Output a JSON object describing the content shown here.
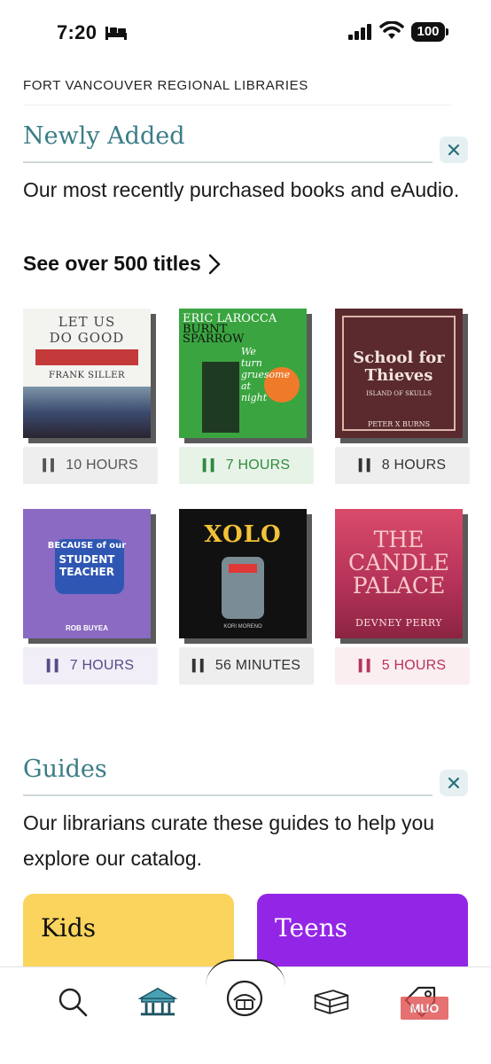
{
  "status_bar": {
    "time": "7:20",
    "battery": "100"
  },
  "library_name": "FORT VANCOUVER REGIONAL LIBRARIES",
  "newly_added": {
    "title": "Newly Added",
    "description": "Our most recently purchased books and eAudio.",
    "see_all": "See over 500 titles",
    "books": [
      {
        "cover_lines": [
          "LET US",
          "DO GOOD",
          "FRANK SILLER"
        ],
        "duration": "10 HOURS",
        "color": "#d0d0d0"
      },
      {
        "cover_lines": [
          "ERIC LAROCCA",
          "BURNT",
          "SPARROW",
          "We turn gruesome at night"
        ],
        "duration": "7 HOURS",
        "color": "#3aa540"
      },
      {
        "cover_lines": [
          "School for Thieves",
          "ISLAND OF SKULLS",
          "PETER X BURNS"
        ],
        "duration": "8 HOURS",
        "color": "#5a2a2e"
      },
      {
        "cover_lines": [
          "BECAUSE of our",
          "STUDENT",
          "TEACHER",
          "ROB BUYEA"
        ],
        "duration": "7 HOURS",
        "color": "#8a6ac2"
      },
      {
        "cover_lines": [
          "XOLO",
          "KORI MORENO"
        ],
        "duration": "56 MINUTES",
        "color": "#111111"
      },
      {
        "cover_lines": [
          "THE",
          "CANDLE",
          "PALACE",
          "DEVNEY PERRY"
        ],
        "duration": "5 HOURS",
        "color": "#b7335a"
      }
    ]
  },
  "guides": {
    "title": "Guides",
    "description": "Our librarians curate these guides to help you explore our catalog.",
    "cards": [
      {
        "label": "Kids",
        "color": "#fad45c"
      },
      {
        "label": "Teens",
        "color": "#9326e6"
      }
    ]
  },
  "tabs": [
    {
      "icon": "search-icon"
    },
    {
      "icon": "library-icon"
    },
    {
      "icon": "reader-icon"
    },
    {
      "icon": "shelf-icon"
    },
    {
      "icon": "tag-icon"
    }
  ],
  "watermark": "MUO"
}
